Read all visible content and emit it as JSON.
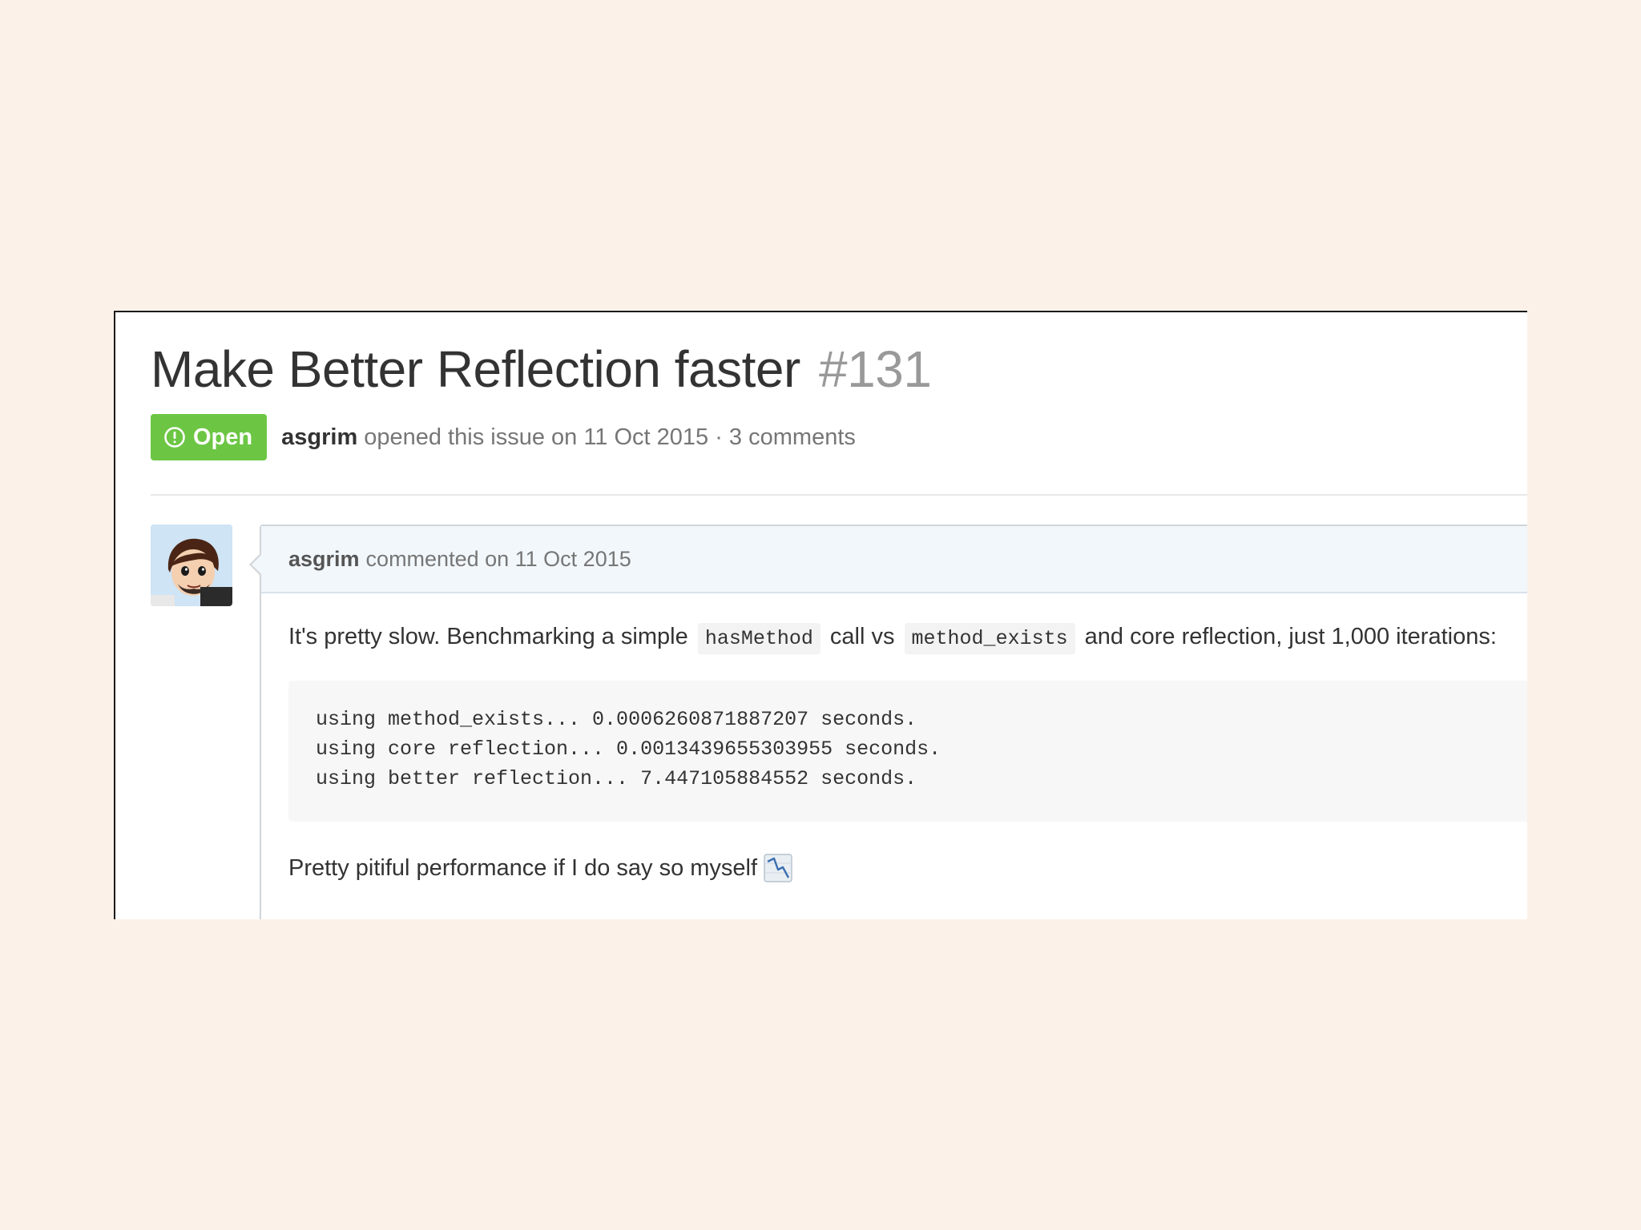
{
  "issue": {
    "title": "Make Better Reflection faster",
    "number": "#131",
    "state_label": "Open",
    "author": "asgrim",
    "meta_text": "opened this issue on 11 Oct 2015 · 3 comments"
  },
  "comment": {
    "author": "asgrim",
    "header_text": "commented on 11 Oct 2015",
    "body": {
      "para1_a": "It's pretty slow. Benchmarking a simple",
      "code1": "hasMethod",
      "para1_b": "call vs",
      "code2": "method_exists",
      "para1_c": "and core reflection, just 1,000 iterations:",
      "code_lines": [
        "using method_exists... 0.0006260871887207 seconds.",
        "using core reflection... 0.0013439655303955 seconds.",
        "using better reflection... 7.447105884552 seconds."
      ],
      "para2": "Pretty pitiful performance if I do say so myself",
      "emoji_icon": "chart-decreasing-icon"
    }
  },
  "colors": {
    "open_badge": "#6cc644",
    "page_background": "#fcf1e8",
    "comment_header": "#f2f7fb"
  }
}
